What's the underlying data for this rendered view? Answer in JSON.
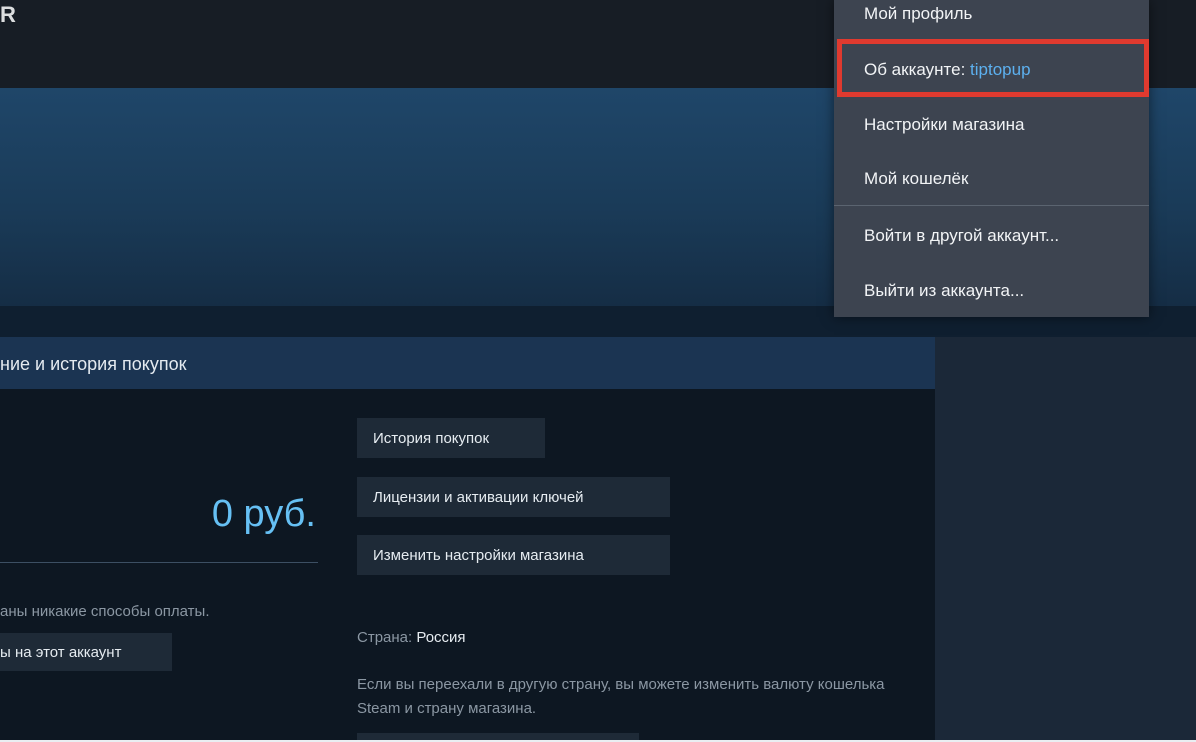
{
  "header": {
    "logo_fragment": "R"
  },
  "section": {
    "title": "ние и история покупок"
  },
  "wallet": {
    "balance": "0 руб.",
    "no_payment_text": "аны никакие способы оплаты.",
    "add_payment_button": "ы на этот аккаунт"
  },
  "buttons": {
    "purchase_history": "История покупок",
    "licenses": "Лицензии и активации ключей",
    "store_settings": "Изменить настройки магазина"
  },
  "country": {
    "label": "Страна: ",
    "value": "Россия",
    "move_text": "Если вы переехали в другую страну, вы можете изменить валюту кошелька Steam и страну магазина."
  },
  "dropdown": {
    "items": [
      "Мой профиль",
      "Об аккаунте: ",
      "Настройки магазина",
      "Мой кошелёк",
      "Войти в другой аккаунт...",
      "Выйти из аккаунта..."
    ],
    "account_name": "tiptopup"
  },
  "colors": {
    "accent": "#66c0f4",
    "highlight": "#e03a2f",
    "dropdown_bg": "#3d4450"
  }
}
